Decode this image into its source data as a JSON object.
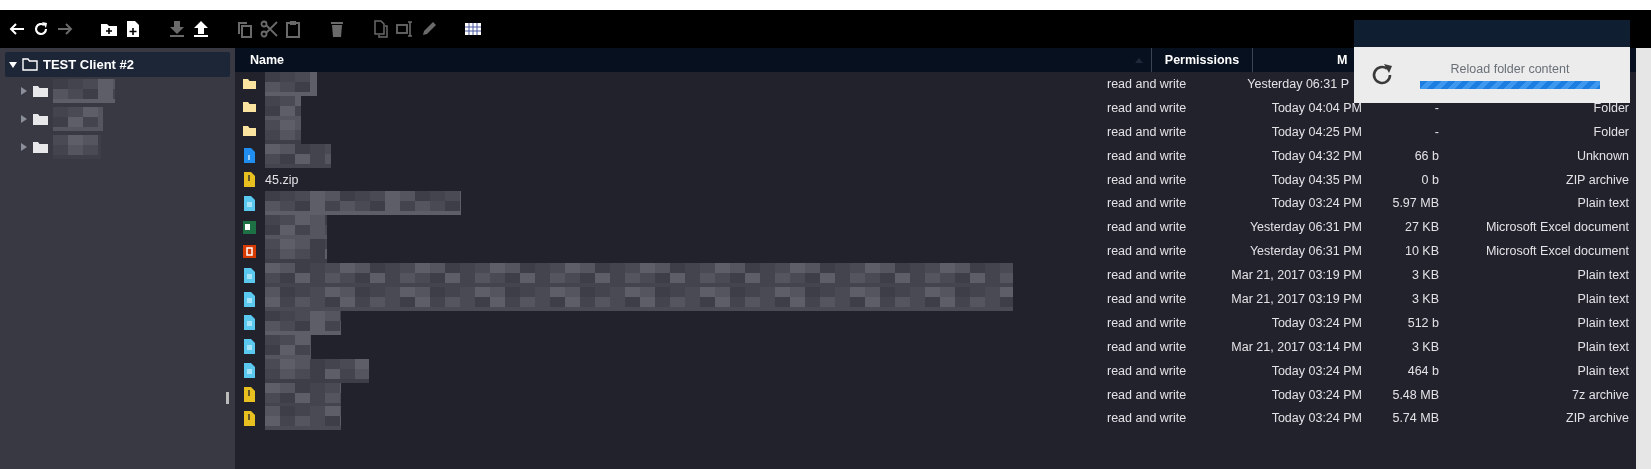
{
  "toolbar": [
    {
      "kind": "back",
      "disabled": false
    },
    {
      "kind": "reload",
      "disabled": false
    },
    {
      "kind": "forward",
      "disabled": true
    },
    {
      "kind": "new-folder",
      "disabled": false
    },
    {
      "kind": "new-file",
      "disabled": false
    },
    {
      "kind": "download",
      "disabled": true
    },
    {
      "kind": "upload",
      "disabled": false
    },
    {
      "kind": "copy",
      "disabled": true
    },
    {
      "kind": "cut",
      "disabled": true
    },
    {
      "kind": "paste",
      "disabled": true
    },
    {
      "kind": "delete",
      "disabled": true
    },
    {
      "kind": "duplicate",
      "disabled": true
    },
    {
      "kind": "rename",
      "disabled": true
    },
    {
      "kind": "edit",
      "disabled": true
    },
    {
      "kind": "grid",
      "disabled": false
    }
  ],
  "tree": [
    {
      "label": "TEST Client #2",
      "selected": true,
      "expanded": true,
      "children": [
        {
          "redacted": true,
          "expanded": false
        },
        {
          "redacted": true,
          "expanded": false
        },
        {
          "redacted": true,
          "expanded": false
        }
      ]
    }
  ],
  "table": {
    "columns": [
      "Name",
      "Permissions",
      "M"
    ],
    "rows": [
      {
        "kind": "folder",
        "redacted": true,
        "permissions": "read and write",
        "modified": "Yesterday 06:31 P"
      },
      {
        "kind": "folder",
        "redacted": true,
        "permissions": "read and write",
        "modified": "Today 04:04 PM",
        "size": "-",
        "type": "Folder"
      },
      {
        "kind": "folder",
        "redacted": true,
        "permissions": "read and write",
        "modified": "Today 04:25 PM",
        "size": "-",
        "type": "Folder"
      },
      {
        "kind": "unknown",
        "redacted": true,
        "permissions": "read and write",
        "modified": "Today 04:32 PM",
        "size": "66 b",
        "type": "Unknown"
      },
      {
        "kind": "archive",
        "redacted": false,
        "name": "45.zip",
        "permissions": "read and write",
        "modified": "Today 04:35 PM",
        "size": "0 b",
        "type": "ZIP archive"
      },
      {
        "kind": "text",
        "redacted": true,
        "permissions": "read and write",
        "modified": "Today 03:24 PM",
        "size": "5.97 MB",
        "type": "Plain text"
      },
      {
        "kind": "excel",
        "redacted": true,
        "permissions": "read and write",
        "modified": "Yesterday 06:31 PM",
        "size": "27 KB",
        "type": "Microsoft Excel document"
      },
      {
        "kind": "office",
        "redacted": true,
        "permissions": "read and write",
        "modified": "Yesterday 06:31 PM",
        "size": "10 KB",
        "type": "Microsoft Excel document"
      },
      {
        "kind": "text",
        "redacted": true,
        "permissions": "read and write",
        "modified": "Mar 21, 2017 03:19 PM",
        "size": "3 KB",
        "type": "Plain text"
      },
      {
        "kind": "text",
        "redacted": true,
        "permissions": "read and write",
        "modified": "Mar 21, 2017 03:19 PM",
        "size": "3 KB",
        "type": "Plain text"
      },
      {
        "kind": "text",
        "redacted": true,
        "permissions": "read and write",
        "modified": "Today 03:24 PM",
        "size": "512 b",
        "type": "Plain text"
      },
      {
        "kind": "text",
        "redacted": true,
        "permissions": "read and write",
        "modified": "Mar 21, 2017 03:14 PM",
        "size": "3 KB",
        "type": "Plain text"
      },
      {
        "kind": "text",
        "redacted": true,
        "permissions": "read and write",
        "modified": "Today 03:24 PM",
        "size": "464 b",
        "type": "Plain text"
      },
      {
        "kind": "archive",
        "redacted": true,
        "permissions": "read and write",
        "modified": "Today 03:24 PM",
        "size": "5.48 MB",
        "type": "7z archive"
      },
      {
        "kind": "archive",
        "redacted": true,
        "permissions": "read and write",
        "modified": "Today 03:24 PM",
        "size": "5.74 MB",
        "type": "ZIP archive"
      }
    ]
  },
  "notification": {
    "message": "Reload folder content",
    "level": 1
  }
}
